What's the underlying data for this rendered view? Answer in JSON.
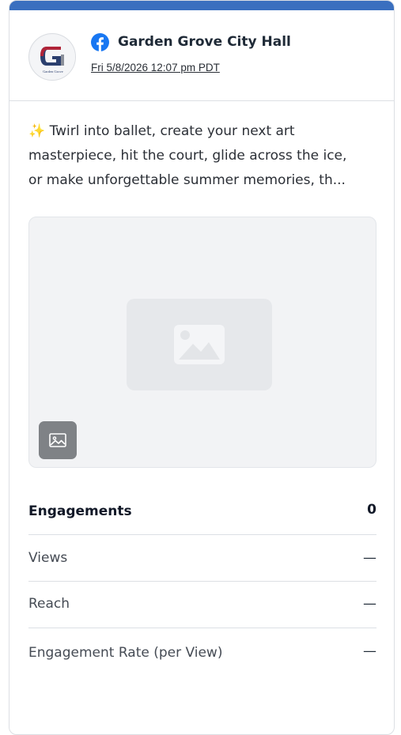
{
  "post": {
    "page_name": "Garden Grove City Hall",
    "timestamp": "Fri 5/8/2026 12:07 pm PDT",
    "avatar_logo_text": "G",
    "avatar_caption": "Garden Grove",
    "network_icon": "facebook-icon",
    "text_lines": [
      "Twirl into ballet, create your next art",
      "masterpiece, hit the court, glide across the ice,",
      "or make unforgettable summer memories, th..."
    ],
    "emoji": "✨",
    "media_placeholder_icon": "image-placeholder-icon",
    "media_type_icon": "image-icon"
  },
  "metrics": [
    {
      "label": "Engagements",
      "value": "0"
    },
    {
      "label": "Views",
      "value": "—"
    },
    {
      "label": "Reach",
      "value": "—"
    },
    {
      "label": "Engagement Rate (per View)",
      "value": "—"
    }
  ],
  "colors": {
    "accent_bar": "#3a6fbf",
    "facebook": "#1877f2",
    "text_primary": "#1f2a37",
    "border": "#dcdfe4"
  }
}
